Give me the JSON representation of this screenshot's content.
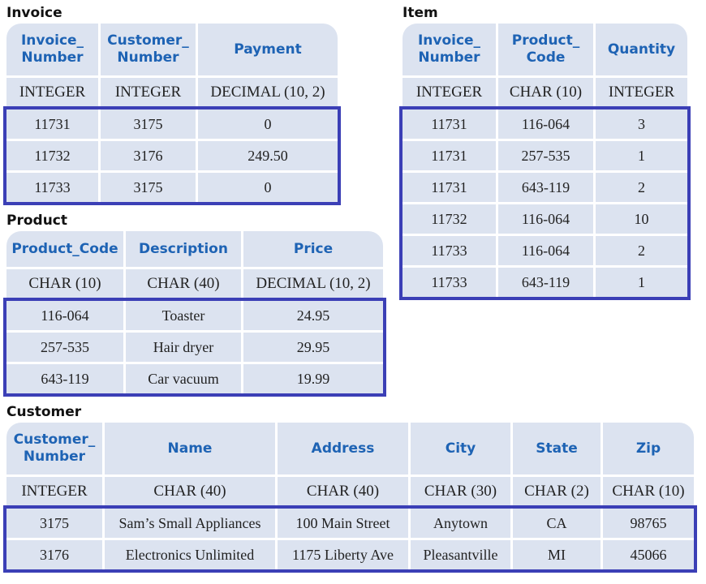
{
  "tables": {
    "invoice": {
      "title": "Invoice",
      "headers": [
        "Invoice_\nNumber",
        "Customer_\nNumber",
        "Payment"
      ],
      "types": [
        "INTEGER",
        "INTEGER",
        "DECIMAL (10, 2)"
      ],
      "rows": [
        [
          "11731",
          "3175",
          "0"
        ],
        [
          "11732",
          "3176",
          "249.50"
        ],
        [
          "11733",
          "3175",
          "0"
        ]
      ]
    },
    "item": {
      "title": "Item",
      "headers": [
        "Invoice_\nNumber",
        "Product_\nCode",
        "Quantity"
      ],
      "types": [
        "INTEGER",
        "CHAR (10)",
        "INTEGER"
      ],
      "rows": [
        [
          "11731",
          "116-064",
          "3"
        ],
        [
          "11731",
          "257-535",
          "1"
        ],
        [
          "11731",
          "643-119",
          "2"
        ],
        [
          "11732",
          "116-064",
          "10"
        ],
        [
          "11733",
          "116-064",
          "2"
        ],
        [
          "11733",
          "643-119",
          "1"
        ]
      ]
    },
    "product": {
      "title": "Product",
      "headers": [
        "Product_Code",
        "Description",
        "Price"
      ],
      "types": [
        "CHAR (10)",
        "CHAR (40)",
        "DECIMAL (10, 2)"
      ],
      "rows": [
        [
          "116-064",
          "Toaster",
          "24.95"
        ],
        [
          "257-535",
          "Hair dryer",
          "29.95"
        ],
        [
          "643-119",
          "Car vacuum",
          "19.99"
        ]
      ]
    },
    "customer": {
      "title": "Customer",
      "headers": [
        "Customer_\nNumber",
        "Name",
        "Address",
        "City",
        "State",
        "Zip"
      ],
      "types": [
        "INTEGER",
        "CHAR (40)",
        "CHAR (40)",
        "CHAR (30)",
        "CHAR (2)",
        "CHAR (10)"
      ],
      "rows": [
        [
          "3175",
          "Sam’s Small Appliances",
          "100 Main Street",
          "Anytown",
          "CA",
          "98765"
        ],
        [
          "3176",
          "Electronics Unlimited",
          "1175 Liberty Ave",
          "Pleasantville",
          "MI",
          "45066"
        ]
      ]
    }
  },
  "colors": {
    "cell_fill": "#dce3f0",
    "header_text": "#1e63b4",
    "outline": "#3b3fb6"
  }
}
